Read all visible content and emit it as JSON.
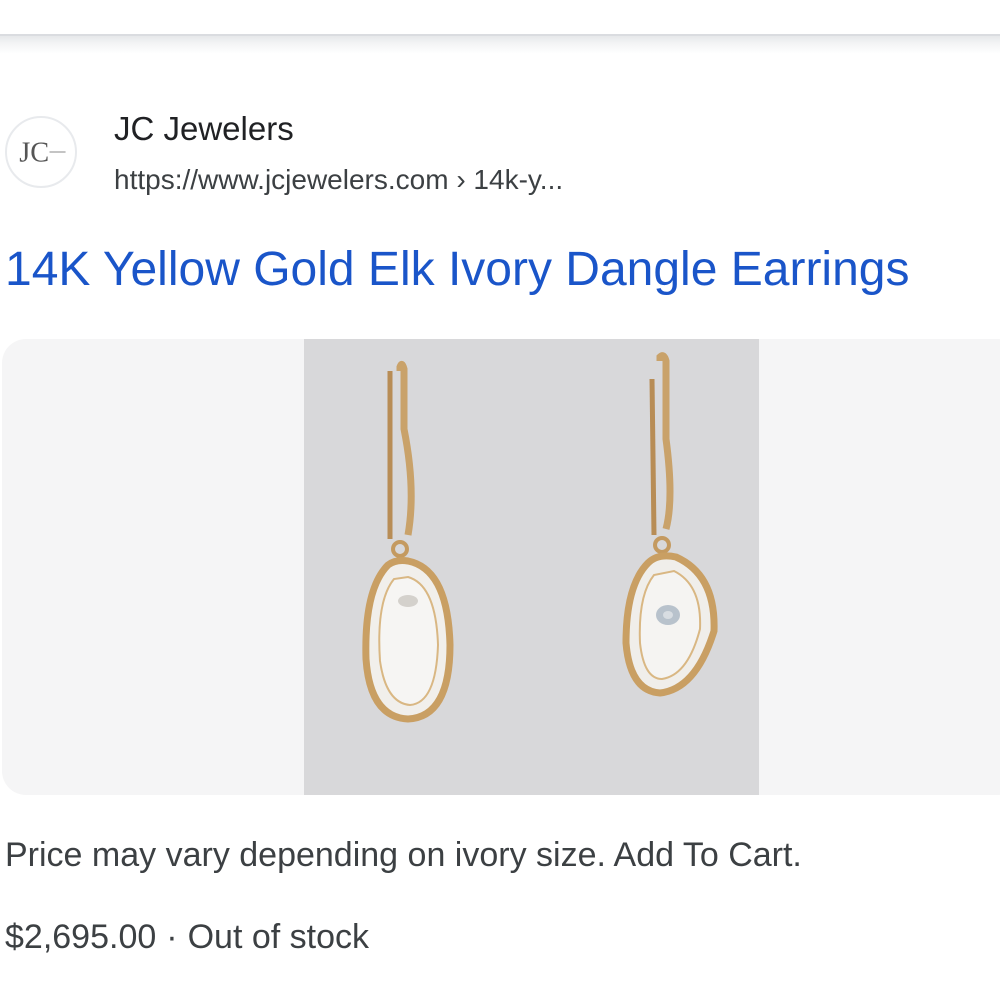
{
  "result": {
    "site_name": "JC Jewelers",
    "site_url": "https://www.jcjewelers.com › 14k-y...",
    "favicon_text": "JC",
    "title": "14K Yellow Gold Elk Ivory Dangle Earrings",
    "snippet": "Price may vary depending on ivory size. Add To Cart.",
    "price": "$2,695.00",
    "separator": "·",
    "availability": "Out of stock"
  },
  "colors": {
    "title_link": "#1a55c9",
    "text": "#3c4043",
    "card_bg": "#f5f5f6"
  },
  "icons": {
    "favicon": "jc-jewelers-logo-icon"
  }
}
